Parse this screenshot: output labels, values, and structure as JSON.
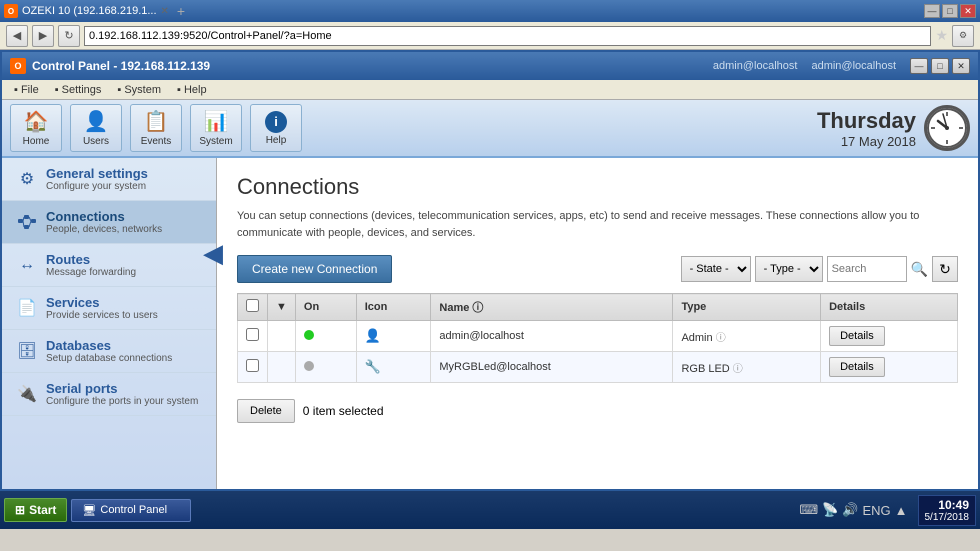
{
  "browser": {
    "tab_title": "OZEKI 10 (192.168.219.1...",
    "address": "0.192.168.112.139:9520/Control+Panel/?a=Home"
  },
  "app": {
    "title": "Control Panel - 192.168.112.139",
    "user": "admin@localhost"
  },
  "menu": {
    "items": [
      "File",
      "Settings",
      "System",
      "Help"
    ]
  },
  "toolbar": {
    "buttons": [
      {
        "label": "Home",
        "icon": "🏠"
      },
      {
        "label": "Users",
        "icon": "👤"
      },
      {
        "label": "Events",
        "icon": "📋"
      },
      {
        "label": "System",
        "icon": "📊"
      },
      {
        "label": "Help",
        "icon": "ℹ"
      }
    ],
    "clock_day": "Thursday",
    "clock_date": "17 May 2018"
  },
  "sidebar": {
    "items": [
      {
        "id": "general",
        "title": "General settings",
        "subtitle": "Configure your system",
        "icon": "⚙"
      },
      {
        "id": "connections",
        "title": "Connections",
        "subtitle": "People, devices, networks",
        "icon": "🔗",
        "active": true
      },
      {
        "id": "routes",
        "title": "Routes",
        "subtitle": "Message forwarding",
        "icon": "↔"
      },
      {
        "id": "services",
        "title": "Services",
        "subtitle": "Provide services to users",
        "icon": "📄"
      },
      {
        "id": "databases",
        "title": "Databases",
        "subtitle": "Setup database connections",
        "icon": "🗄"
      },
      {
        "id": "serial_ports",
        "title": "Serial ports",
        "subtitle": "Configure the ports in your system",
        "icon": "🔌"
      }
    ]
  },
  "content": {
    "title": "Connections",
    "description": "You can setup connections (devices, telecommunication services, apps, etc) to send and receive messages. These connections allow you to communicate with people, devices, and services.",
    "create_btn": "Create new Connection",
    "filter_state": "- State -",
    "filter_type": "- Type -",
    "search_placeholder": "Search",
    "refresh_btn": "↻",
    "table": {
      "headers": [
        "",
        "",
        "On",
        "Icon",
        "Name",
        "Type",
        "Details"
      ],
      "rows": [
        {
          "checked": false,
          "on": true,
          "icon": "person",
          "name": "admin@localhost",
          "type": "Admin",
          "type_info": true,
          "details": "Details"
        },
        {
          "checked": false,
          "on": false,
          "icon": "device",
          "name": "MyRGBLed@localhost",
          "type": "RGB LED",
          "type_info": true,
          "details": "Details"
        }
      ]
    },
    "delete_btn": "Delete",
    "selected_text": "0 item selected"
  },
  "taskbar": {
    "start_label": "Start",
    "panel_label": "Control Panel",
    "time": "10:49",
    "date": "5/17/2018",
    "systray_icons": [
      "⌨",
      "🔊",
      "🌐",
      "ENG"
    ]
  }
}
